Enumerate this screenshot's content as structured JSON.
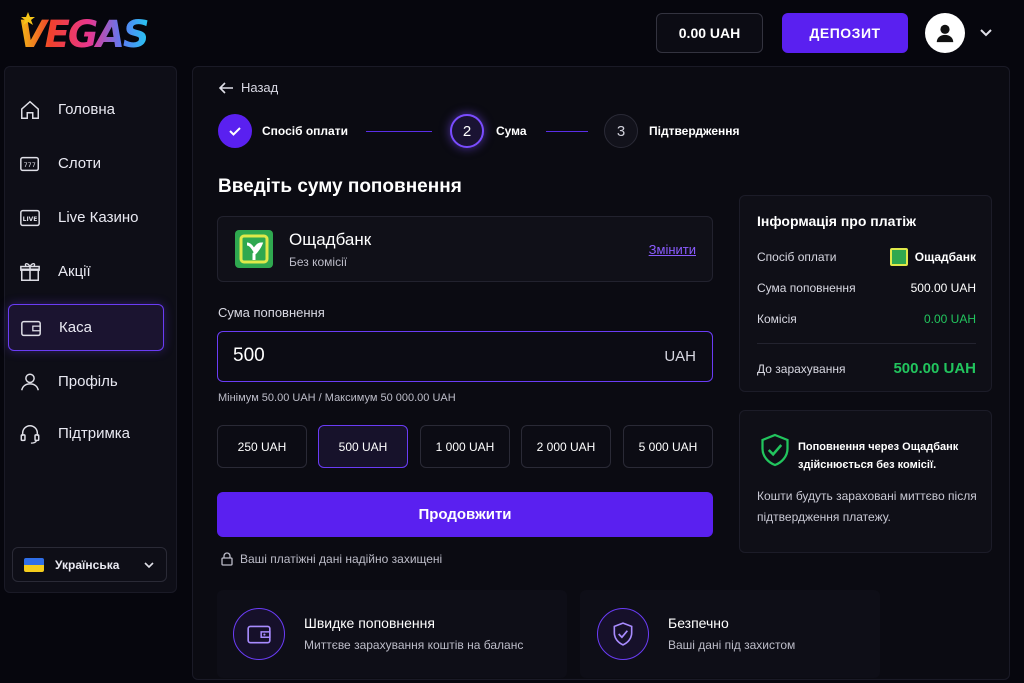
{
  "header": {
    "logo_text": "VEGAS",
    "balance": "0.00 UAH",
    "deposit_label": "ДЕПОЗИТ"
  },
  "sidebar": {
    "items": [
      {
        "label": "Головна",
        "icon": "home-icon"
      },
      {
        "label": "Слоти",
        "icon": "slot-machine-icon"
      },
      {
        "label": "Live Казино",
        "icon": "live-icon"
      },
      {
        "label": "Акції",
        "icon": "gift-icon"
      },
      {
        "label": "Каса",
        "icon": "wallet-icon",
        "active": true
      },
      {
        "label": "Профіль",
        "icon": "user-icon"
      },
      {
        "label": "Підтримка",
        "icon": "headset-icon"
      }
    ],
    "language": "Українська",
    "live_badge": "LIVE"
  },
  "main": {
    "back_label": "Назад",
    "steps": [
      {
        "num": "",
        "label": "Спосіб оплати",
        "state": "done"
      },
      {
        "num": "2",
        "label": "Сума",
        "state": "current"
      },
      {
        "num": "3",
        "label": "Підтвердження",
        "state": "pending"
      }
    ],
    "title": "Введіть суму поповнення",
    "bank": {
      "name": "Ощадбанк",
      "fee": "Без комісії",
      "change_label": "Змінити"
    },
    "amount_label": "Сума поповнення",
    "amount_value": "500",
    "currency": "UAH",
    "limits": "Мінімум 50.00 UAH / Максимум 50 000.00 UAH",
    "quick_amounts": [
      "250 UAH",
      "500 UAH",
      "1 000 UAH",
      "2 000 UAH",
      "5 000 UAH"
    ],
    "selected_quick": 1,
    "continue_label": "Продовжити",
    "secure_text": "Ваші платіжні дані надійно захищені",
    "features": [
      {
        "title": "Швидке поповнення",
        "desc": "Миттєве зарахування коштів на баланс",
        "icon": "wallet-icon"
      },
      {
        "title": "Безпечно",
        "desc": "Ваші дані під захистом",
        "icon": "shield-check-icon"
      }
    ]
  },
  "info": {
    "title": "Інформація про платіж",
    "rows": [
      {
        "label": "Спосіб оплати",
        "value": "Ощадбанк"
      },
      {
        "label": "Сума поповнення",
        "value": "500.00 UAH"
      },
      {
        "label": "Комісія",
        "value": "0.00 UAH"
      }
    ],
    "total_label": "До зарахування",
    "total_value": "500.00 UAH",
    "note_title": "Поповнення через Ощадбанк здійснюється без комісії.",
    "note_text": "Кошти будуть зараховані миттєво після підтвердження платежу."
  },
  "colors": {
    "accent": "#5a20f0",
    "green": "#22c55e",
    "bank_green": "#2fa84f"
  }
}
